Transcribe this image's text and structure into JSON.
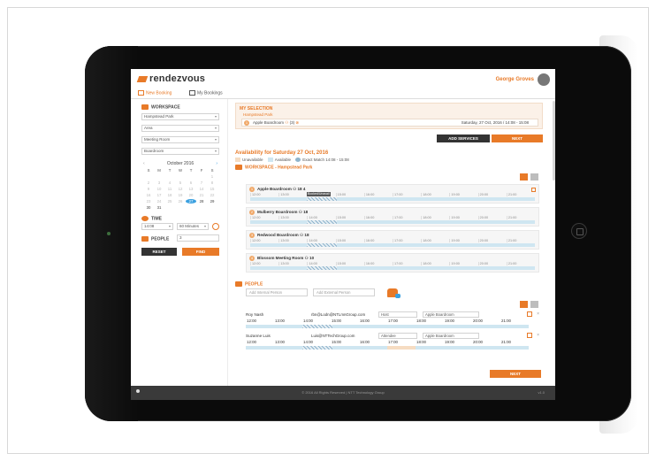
{
  "app": {
    "logo": "rendezvous",
    "user_name": "George Groves"
  },
  "tabs": [
    {
      "label": "New Booking",
      "active": true
    },
    {
      "label": "My Bookings",
      "active": false
    }
  ],
  "sidebar": {
    "workspace_heading": "WORKSPACE",
    "selects": [
      "Hampstead Park",
      "Area",
      "Meeting Room",
      "Boardroom"
    ],
    "calendar": {
      "month": "October 2016",
      "weekdays": [
        "S",
        "M",
        "T",
        "W",
        "T",
        "F",
        "S"
      ],
      "days": [
        "",
        "",
        "",
        "",
        "",
        "",
        "1",
        "2",
        "3",
        "4",
        "5",
        "6",
        "7",
        "8",
        "9",
        "10",
        "11",
        "12",
        "13",
        "14",
        "15",
        "16",
        "17",
        "18",
        "19",
        "20",
        "21",
        "22",
        "23",
        "24",
        "25",
        "26",
        "27",
        "28",
        "29",
        "30",
        "31"
      ],
      "selected_day": "27"
    },
    "time_heading": "TIME",
    "time_start": "14:08",
    "time_duration": "60 Minutes",
    "people_heading": "PEOPLE",
    "people_count": "3",
    "reset_label": "RESET",
    "find_label": "FIND"
  },
  "selection": {
    "title": "MY SELECTION",
    "location": "Hampstead Park",
    "room": "Apple Boardroom",
    "room_capacity": "(3)",
    "date_time": "Saturday, 27 Oct, 2016  /  14:08 - 15:08",
    "add_services_label": "ADD SERVICES",
    "next_label": "NEXT"
  },
  "availability": {
    "title": "Availability for Saturday 27 Oct, 2016",
    "legend": [
      {
        "label": "Unavailable",
        "color": "#f6dcc2"
      },
      {
        "label": "Available",
        "color": "#cfe6f1"
      },
      {
        "label": "Exact Match 14:08 - 15:08",
        "color": "#8fb4cc"
      }
    ],
    "workspace_title": "WORKSPACE - Hampstead Park",
    "time_slots": [
      "12:00",
      "13:00",
      "14:00",
      "15:00",
      "16:00",
      "17:00",
      "18:00",
      "19:00",
      "20:00",
      "21:00"
    ],
    "rooms": [
      {
        "num": "1",
        "name": "Apple Boardroom",
        "meta": "18  4",
        "selected": true,
        "tag": "Booked/Unavail"
      },
      {
        "num": "2",
        "name": "Mulberry Boardroom",
        "meta": "18",
        "selected": false,
        "tag": ""
      },
      {
        "num": "3",
        "name": "Redwood Boardroom",
        "meta": "18",
        "selected": false,
        "tag": ""
      },
      {
        "num": "4",
        "name": "Blossom Meeting Room",
        "meta": "10",
        "selected": false,
        "tag": ""
      }
    ]
  },
  "people": {
    "title": "PEOPLE",
    "add_internal_placeholder": "Add Internal Person",
    "add_external_placeholder": "Add External Person",
    "rows": [
      {
        "name": "Roy Nash",
        "email": "rbn@Lodn@NTLmnGroup.com",
        "role": "Host",
        "room": "Apple Boardroom",
        "times": [
          "12:00",
          "13:00",
          "14:00",
          "15:00",
          "16:00",
          "17:00",
          "18:00",
          "19:00",
          "20:00",
          "21:00"
        ]
      },
      {
        "name": "Suzanne Luis",
        "email": "Luis@NTTechGroup.com",
        "role": "Attendee",
        "room": "Apple Boardroom",
        "times": [
          "12:00",
          "13:00",
          "14:00",
          "15:00",
          "16:00",
          "17:00",
          "18:00",
          "19:00",
          "20:00",
          "21:00"
        ]
      }
    ],
    "next_label": "NEXT"
  },
  "footer": {
    "copyright": "© 2016 All Rights Reserved | NTT Technology Group",
    "version": "v1.0"
  }
}
